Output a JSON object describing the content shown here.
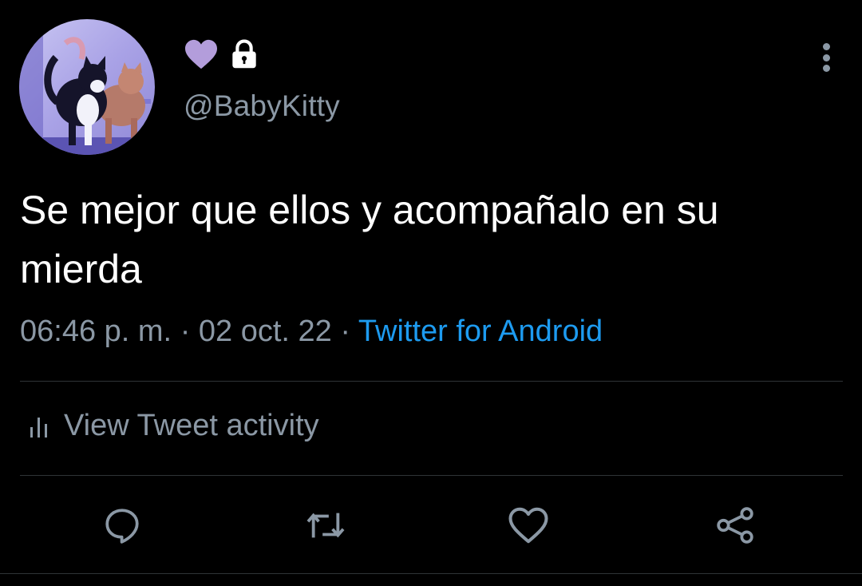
{
  "author": {
    "handle": "@BabyKitty",
    "avatar_icon": "cat-photo-avatar",
    "name_icons": [
      "purple-heart-icon",
      "lock-icon"
    ],
    "heart_color": "#b39ddb"
  },
  "tweet": {
    "text": "Se mejor que ellos y acompañalo en su mierda",
    "time": "06:46 p. m.",
    "separator": "·",
    "date": "02 oct. 22",
    "source": "Twitter for Android"
  },
  "activity": {
    "label": "View Tweet activity",
    "icon": "bar-chart-icon"
  },
  "actions": [
    {
      "name": "reply",
      "icon": "reply-icon"
    },
    {
      "name": "retweet",
      "icon": "retweet-icon"
    },
    {
      "name": "like",
      "icon": "heart-outline-icon"
    },
    {
      "name": "share",
      "icon": "share-icon"
    }
  ],
  "colors": {
    "background": "#000000",
    "text": "#ffffff",
    "muted": "#8b98a5",
    "link": "#1d9bf0",
    "divider": "#2f3336"
  }
}
